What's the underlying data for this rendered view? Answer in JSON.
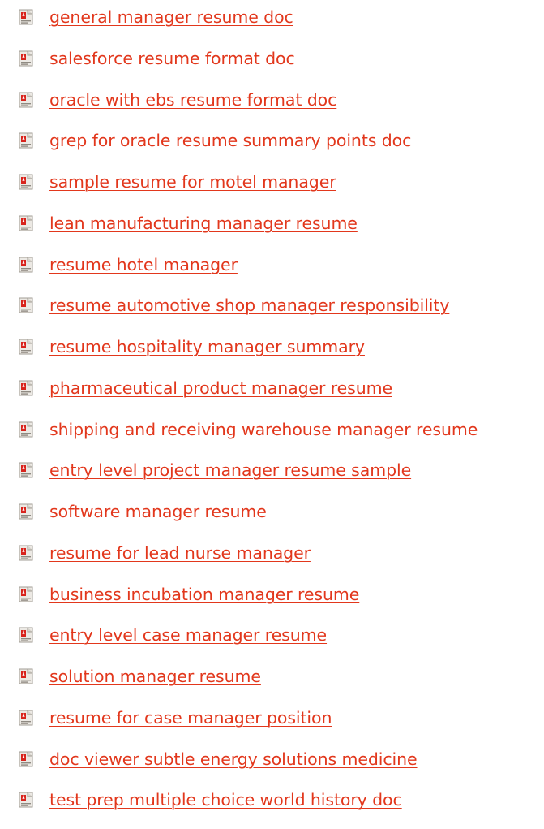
{
  "icon": "pdf-file-icon",
  "link_color": "#e2371c",
  "links": [
    "general manager resume doc",
    "salesforce resume format doc",
    "oracle with ebs resume format doc",
    "grep for oracle resume summary points doc",
    "sample resume for motel manager",
    "lean manufacturing manager resume",
    "resume hotel manager",
    "resume automotive shop manager responsibility",
    "resume hospitality manager summary",
    "pharmaceutical product manager resume",
    "shipping and receiving warehouse manager resume",
    "entry level project manager resume sample",
    "software manager resume",
    "resume for lead nurse manager",
    "business incubation manager resume",
    "entry level case manager resume",
    "solution manager resume",
    "resume for case manager position",
    "doc viewer subtle energy solutions medicine",
    "test prep multiple choice world history doc"
  ]
}
